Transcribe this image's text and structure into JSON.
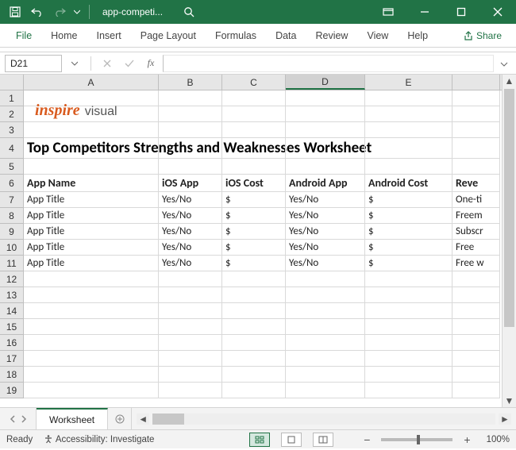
{
  "titlebar": {
    "doc_name": "app-competi..."
  },
  "ribbon": {
    "file": "File",
    "home": "Home",
    "insert": "Insert",
    "page_layout": "Page Layout",
    "formulas": "Formulas",
    "data": "Data",
    "review": "Review",
    "view": "View",
    "help": "Help",
    "share": "Share"
  },
  "fx": {
    "name_box": "D21",
    "fx_label": "fx"
  },
  "columns": [
    "A",
    "B",
    "C",
    "D",
    "E"
  ],
  "rows": [
    "1",
    "2",
    "3",
    "4",
    "5",
    "6",
    "7",
    "8",
    "9",
    "10",
    "11",
    "12",
    "13",
    "14",
    "15",
    "16",
    "17",
    "18",
    "19"
  ],
  "logo": {
    "inspire": "inspire",
    "visual": "visual"
  },
  "sheet_title": "Top Competitors Strengths and Weaknesses Worksheet",
  "headers": {
    "a": "App Name",
    "b": "iOS App",
    "c": "iOS Cost",
    "d": "Android App",
    "e": "Android Cost",
    "f": "Reve"
  },
  "data_rows": [
    {
      "a": "App Title",
      "b": "Yes/No",
      "c": "$",
      "d": "Yes/No",
      "e": "$",
      "f": "One-ti"
    },
    {
      "a": "App Title",
      "b": "Yes/No",
      "c": "$",
      "d": "Yes/No",
      "e": "$",
      "f": "Freem"
    },
    {
      "a": "App Title",
      "b": "Yes/No",
      "c": "$",
      "d": "Yes/No",
      "e": "$",
      "f": "Subscr"
    },
    {
      "a": "App Title",
      "b": "Yes/No",
      "c": "$",
      "d": "Yes/No",
      "e": "$",
      "f": "Free"
    },
    {
      "a": "App Title",
      "b": "Yes/No",
      "c": "$",
      "d": "Yes/No",
      "e": "$",
      "f": "Free w"
    }
  ],
  "sheet_tab": "Worksheet",
  "status": {
    "ready": "Ready",
    "accessibility": "Accessibility: Investigate",
    "zoom": "100%"
  }
}
